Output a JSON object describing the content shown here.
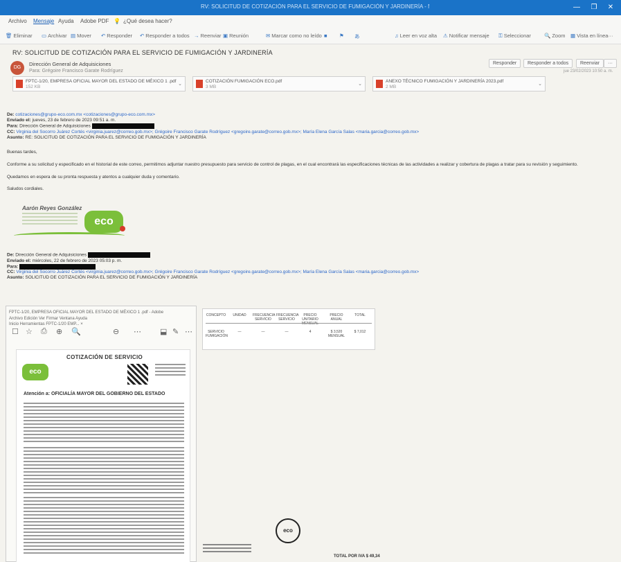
{
  "window": {
    "title": "RV: SOLICITUD DE COTIZACIÓN PARA EL SERVICIO DE FUMIGACIÓN Y JARDINERÍA - Mensaje (HTML)",
    "controls": [
      "—",
      "❐",
      "✕"
    ]
  },
  "menu": {
    "items": [
      "Archivo",
      "Mensaje",
      "Ayuda",
      "Adobe PDF"
    ],
    "search": "¿Qué desea hacer?"
  },
  "ribbon": {
    "items": [
      {
        "icon": "trash-icon",
        "label": "Eliminar"
      },
      {
        "icon": "archive-icon",
        "label": "Archivar"
      },
      {
        "icon": "move-icon",
        "label": "Mover"
      },
      {
        "icon": "reply-icon",
        "label": "Responder"
      },
      {
        "icon": "reply-all-icon",
        "label": "Responder a todos"
      },
      {
        "icon": "forward-icon",
        "label": "Reenviar"
      },
      {
        "icon": "teams-icon",
        "label": "Reunión"
      },
      {
        "icon": "envelope-icon",
        "label": "Marcar como no leído"
      },
      {
        "icon": "tag-icon",
        "label": "Categorizar"
      },
      {
        "icon": "flag-icon",
        "label": "Seguimiento"
      },
      {
        "icon": "translate-icon",
        "label": "Traducir"
      },
      {
        "icon": "read-aloud-icon",
        "label": "Leer en voz alta"
      },
      {
        "icon": "report-icon",
        "label": "Notificar mensaje"
      },
      {
        "icon": "lock-icon",
        "label": "Seleccionar"
      },
      {
        "icon": "zoom-icon",
        "label": "Zoom"
      },
      {
        "icon": "view-icon",
        "label": "Vista en línea"
      },
      {
        "icon": "more-icon",
        "label": "···"
      }
    ]
  },
  "message": {
    "subject": "RV: SOLICITUD DE COTIZACIÓN PARA EL SERVICIO DE FUMIGACIÓN Y JARDINERÍA",
    "avatar_initials": "DG",
    "sender": "Dirección General de Adquisiciones",
    "to": "Para: Grégoire Francisco Garate Rodríguez",
    "actions": [
      "Responder",
      "Responder a todos",
      "Reenviar",
      "···"
    ],
    "date": "jue 23/02/2023 10:50 a. m.",
    "attachments": [
      {
        "name": "FPTC-1/20, EMPRESA OFICIAL MAYOR DEL ESTADO DE MÉXICO 1 .pdf",
        "size": "152 KB"
      },
      {
        "name": "COTIZACIÓN FUMIGACIÓN ECO.pdf",
        "size": "3 MB"
      },
      {
        "name": "ANEXO TÉCNICO FUMIGACIÓN Y JARDINERÍA 2023.pdf",
        "size": "2 MB"
      }
    ]
  },
  "forwarded_1": {
    "de_label": "De:",
    "de_value": "cotizaciones@grupo-eco.com.mx <cotizaciones@grupo-eco.com.mx>",
    "enviado_label": "Enviado el:",
    "enviado_value": "jueves, 23 de febrero de 2023 09:51 a. m.",
    "para_label": "Para:",
    "para_value": "Dirección General de Adquisiciones",
    "cc_label": "CC:",
    "cc_value": "Virginia del Socorro Juárez Cortés <virginia.juarez@correo.gob.mx>; Grégoire Francisco Garate Rodríguez <gregoire.garate@correo.gob.mx>; María Elena García Salas <maria.garcia@correo.gob.mx>",
    "asunto_label": "Asunto:",
    "asunto_value": "RE: SOLICITUD DE COTIZACIÓN PARA EL SERVICIO DE FUMIGACIÓN Y JARDINERÍA"
  },
  "body": {
    "greeting": "Buenas tardes,",
    "paragraph1": "Conforme a su solicitud y especificado en el historial de este correo, permitimos adjuntar nuestro presupuesto para servicio de control de plagas, en el cual encontrará las especificaciones técnicas de las actividades a realizar y cobertura de plagas a tratar para su revisión y seguimiento.",
    "paragraph2": "Quedamos en espera de su pronta respuesta y atentos a cualquier duda y comentario.",
    "closing": "Saludos cordiales."
  },
  "signature": {
    "name": "Aarón Reyes González",
    "logo_text": "eco"
  },
  "forwarded_2": {
    "de_label": "De:",
    "de_value": "Dirección General de Adquisiciones",
    "enviado_label": "Enviado el:",
    "enviado_value": "miércoles, 22 de febrero de 2023 05:03 p. m.",
    "para_label": "Para:",
    "cc_label": "CC:",
    "cc_value": "Virginia del Socorro Juárez Cortés <virginia.juarez@correo.gob.mx>; Grégoire Francisco Garate Rodríguez <gregoire.garate@correo.gob.mx>; María Elena García Salas <maria.garcia@correo.gob.mx>",
    "asunto_label": "Asunto:",
    "asunto_value": "SOLICITUD DE COTIZACIÓN PARA EL SERVICIO DE FUMIGACIÓN Y JARDINERÍA"
  },
  "scan_left": {
    "tab": "FPTC-1/20, EMPRESA OFICIAL MAYOR DEL ESTADO DE MÉXICO 1 .pdf - Adobe",
    "menu": "Archivo  Edición  Ver  Firmar  Ventana  Ayuda",
    "tabs": "Inicio    Herramientas    FPTC-1/20 EMP...  ×",
    "toolbar_icons": [
      "☐",
      "☆",
      "⎙",
      "⊕",
      "🔍",
      "⊖",
      "⋯",
      "⬓",
      "✎",
      "⋯"
    ],
    "heading": "COTIZACIÓN DE SERVICIO",
    "logo_text": "eco",
    "attention": "Atención a: OFICIALÍA MAYOR DEL GOBIERNO DEL ESTADO"
  },
  "scan_right": {
    "headers": [
      "CONCEPTO",
      "UNIDAD",
      "FRECUENCIA SERVICIO",
      "FRECUENCIA SERVICIO",
      "PRECIO UNITARIO MENSUAL",
      "PRECIO ANUAL",
      "TOTAL"
    ],
    "row": [
      "SERVICIO FUMIGACIÓN",
      "—",
      "—",
      "—",
      "4",
      "$ 3,520 MENSUAL",
      "$ 7,012"
    ]
  },
  "footer": {
    "stamp": "eco",
    "total": "TOTAL POR IVA  $ 49,34"
  }
}
